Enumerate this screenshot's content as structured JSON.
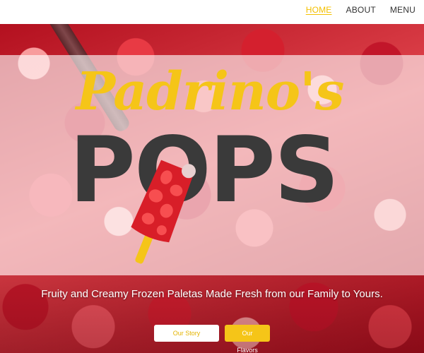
{
  "nav": {
    "links": [
      {
        "label": "HOME",
        "active": true
      },
      {
        "label": "ABOUT",
        "active": false
      },
      {
        "label": "MENU",
        "active": false
      }
    ]
  },
  "hero": {
    "logo": {
      "script": "Padrino's",
      "word": [
        "P",
        "O",
        "P",
        "S"
      ],
      "script_color": "#f5c518",
      "word_color": "#3a3a3a",
      "popsicle_color": "#d81e28"
    },
    "tagline": "Fruity and Creamy Frozen Paletas Made Fresh from our Family to Yours.",
    "buttons": {
      "story": "Our Story",
      "flavors": "Our Flavors"
    }
  },
  "colors": {
    "accent": "#f5c518",
    "text_dark": "#333333"
  }
}
